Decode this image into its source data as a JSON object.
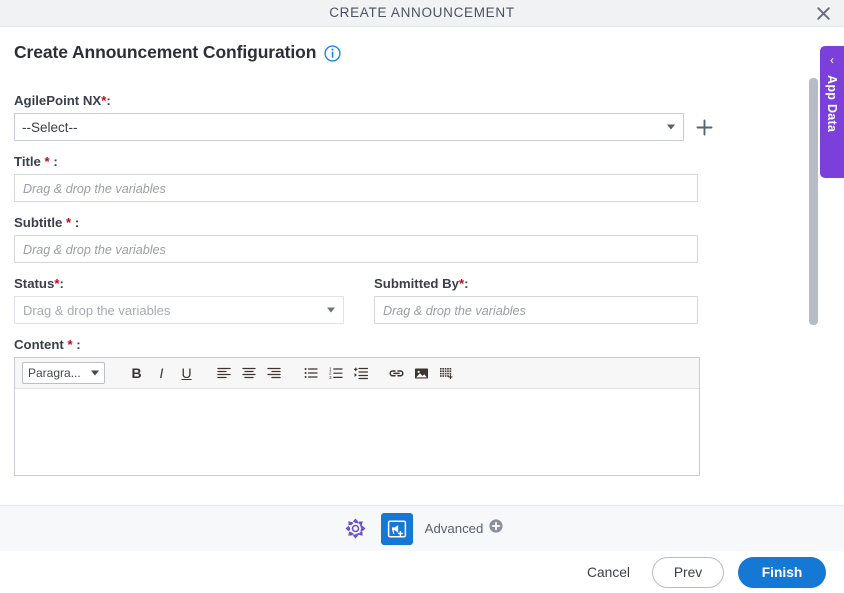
{
  "window": {
    "title": "CREATE ANNOUNCEMENT",
    "close_icon": "close-icon"
  },
  "page": {
    "heading": "Create Announcement Configuration",
    "info_icon": "info-icon"
  },
  "form": {
    "fields": [
      {
        "label": "AgilePoint NX",
        "required_mark": "*",
        "suffix": ":",
        "type": "select",
        "value": "--Select--",
        "add_icon": "plus-icon"
      },
      {
        "label": "Title",
        "required_mark": "*",
        "suffix": ":",
        "type": "text",
        "value": "",
        "placeholder": "Drag & drop the variables"
      },
      {
        "label": "Subtitle",
        "required_mark": "*",
        "suffix": ":",
        "type": "text",
        "value": "",
        "placeholder": "Drag & drop the variables"
      },
      {
        "label": "Status",
        "required_mark": "*",
        "suffix": ":",
        "type": "select",
        "value": "Drag & drop the variables",
        "disabled": true
      },
      {
        "label": "Submitted By",
        "required_mark": "*",
        "suffix": ":",
        "type": "text",
        "value": "",
        "placeholder": "Drag & drop the variables"
      },
      {
        "label": "Content",
        "required_mark": "*",
        "suffix": ":",
        "type": "richtext",
        "value": ""
      }
    ]
  },
  "editor": {
    "format_select": "Paragra...",
    "buttons": [
      {
        "name": "bold-icon",
        "label": "B"
      },
      {
        "name": "italic-icon",
        "label": "I"
      },
      {
        "name": "underline-icon",
        "label": "U"
      },
      {
        "name": "align-left-icon",
        "label": ""
      },
      {
        "name": "align-center-icon",
        "label": ""
      },
      {
        "name": "align-right-icon",
        "label": ""
      },
      {
        "name": "bullet-list-icon",
        "label": ""
      },
      {
        "name": "numbered-list-icon",
        "label": ""
      },
      {
        "name": "indent-icon",
        "label": ""
      },
      {
        "name": "link-icon",
        "label": ""
      },
      {
        "name": "image-icon",
        "label": ""
      },
      {
        "name": "table-icon",
        "label": ""
      }
    ]
  },
  "app_data_tab": {
    "label": "App Data",
    "chevron": "‹",
    "color": "#7b3fdb"
  },
  "action_bar": {
    "settings_icon": "gear-icon",
    "announcement_icon": "announcement-add-icon",
    "advanced_label": "Advanced",
    "advanced_icon": "plus-circle-icon",
    "active_color": "#1478d4"
  },
  "footer": {
    "cancel_label": "Cancel",
    "prev_label": "Prev",
    "finish_label": "Finish",
    "finish_color": "#1478d4"
  }
}
